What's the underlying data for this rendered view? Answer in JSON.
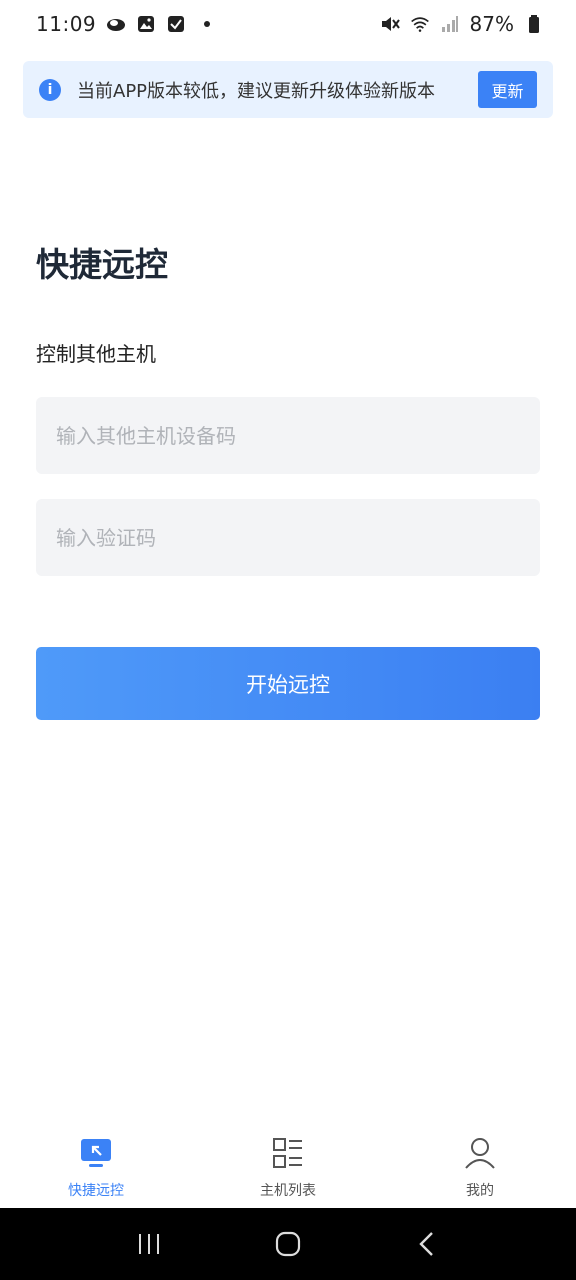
{
  "status_bar": {
    "time": "11:09",
    "battery": "87%"
  },
  "banner": {
    "text": "当前APP版本较低，建议更新升级体验新版本",
    "button_label": "更新",
    "accent": "#3b82f6",
    "background": "#e8f2ff"
  },
  "main": {
    "title": "快捷远控",
    "section_label": "控制其他主机",
    "device_input": {
      "value": "",
      "placeholder": "输入其他主机设备码"
    },
    "code_input": {
      "value": "",
      "placeholder": "输入验证码"
    },
    "start_button_label": "开始远控"
  },
  "tabs": [
    {
      "label": "快捷远控",
      "icon": "remote-screen-icon",
      "active": true
    },
    {
      "label": "主机列表",
      "icon": "host-list-icon",
      "active": false
    },
    {
      "label": "我的",
      "icon": "person-icon",
      "active": false
    }
  ],
  "colors": {
    "primary": "#3b82f6",
    "input_bg": "#f3f4f6"
  }
}
